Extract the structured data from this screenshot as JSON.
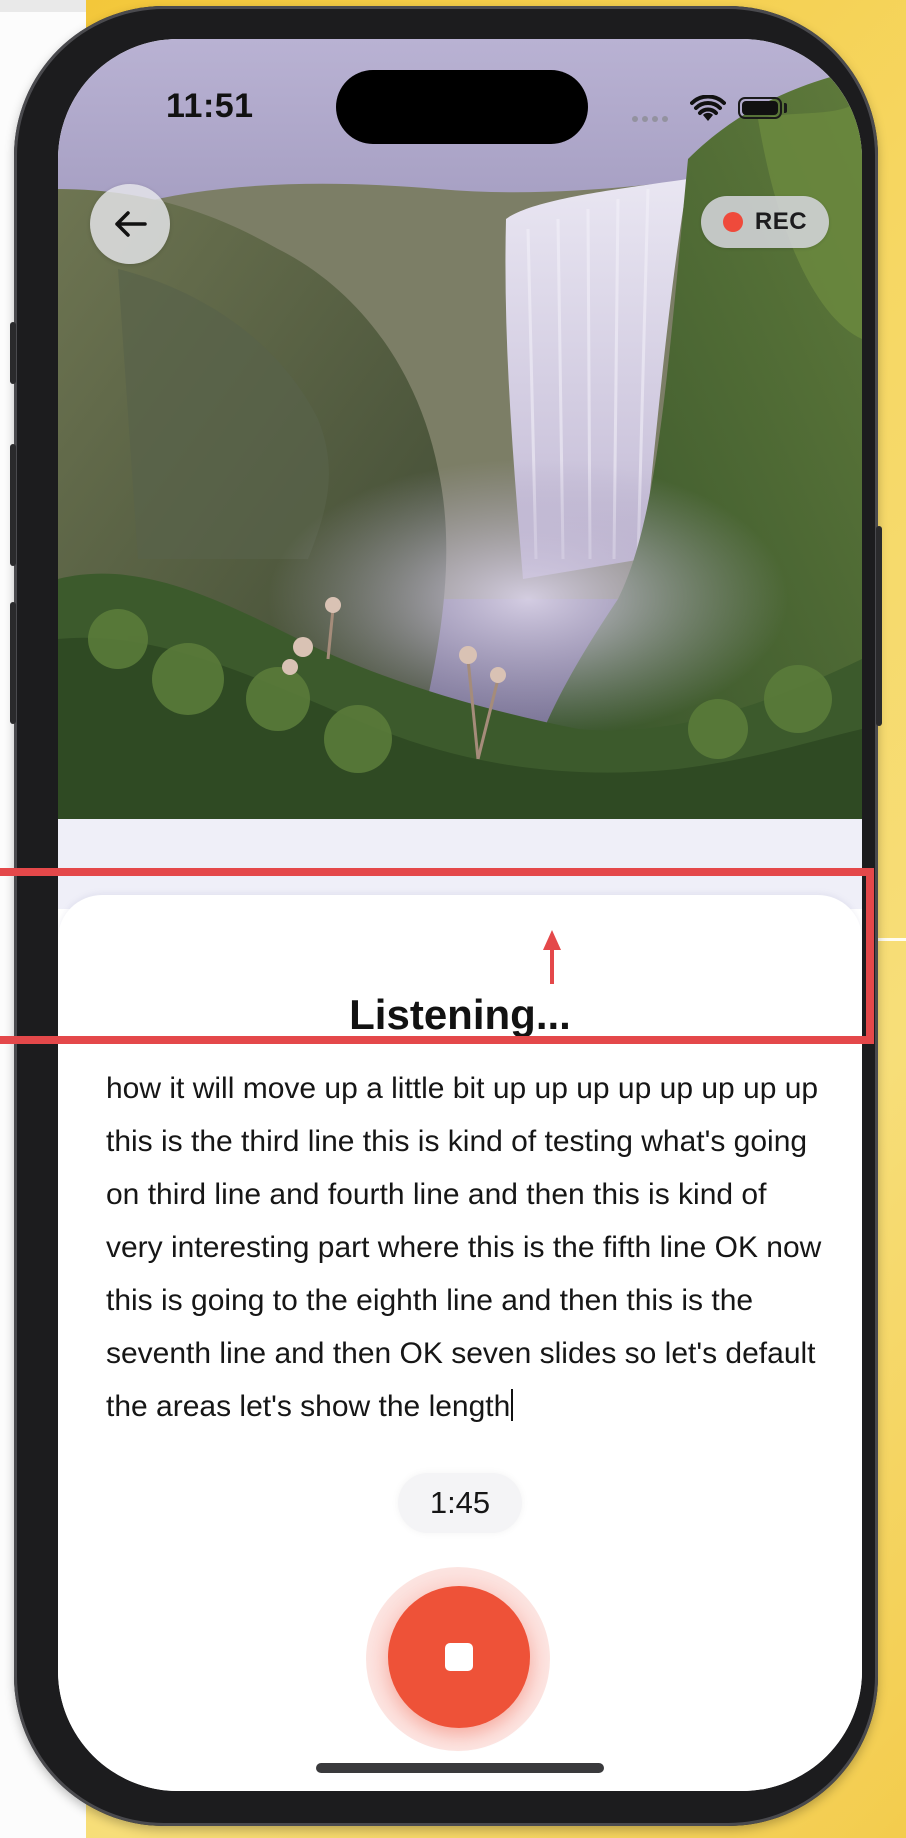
{
  "status_bar": {
    "time": "11:51",
    "wifi_icon": "wifi-icon",
    "battery_icon": "battery-icon"
  },
  "header": {
    "back_icon": "arrow-left-icon",
    "rec_label": "REC",
    "rec_dot_color": "#ef4a3b"
  },
  "photo": {
    "subject": "waterfall-image"
  },
  "main": {
    "title": "Listening...",
    "transcript": "how it will move up a little bit up up up up up up up up this is the third line this is kind of testing what's going on third line and fourth line and then this is kind of very interesting part where this is the fifth line OK now this is going to the eighth line and then this is the seventh line and then OK seven slides so let's default the areas let's show the length",
    "timer": "1:45"
  },
  "controls": {
    "stop_icon": "stop-icon",
    "accent_color": "#ee5238"
  },
  "annotation": {
    "box_color": "#e4484a",
    "arrow_icon": "arrow-up-icon"
  }
}
